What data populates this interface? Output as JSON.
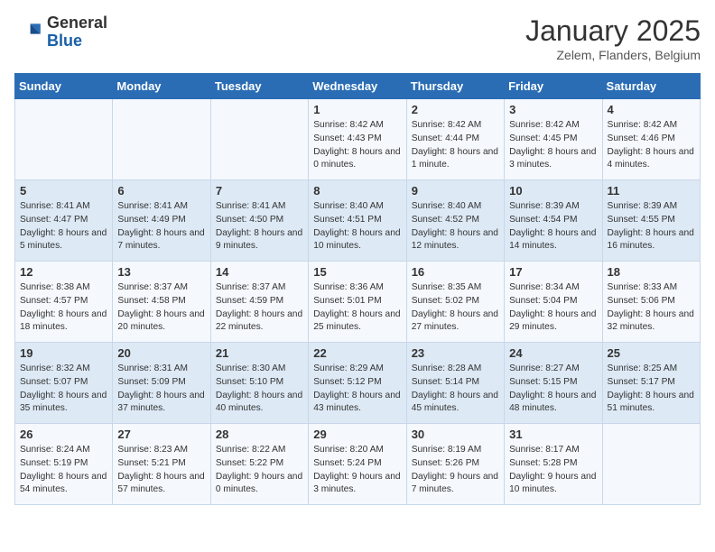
{
  "header": {
    "logo_general": "General",
    "logo_blue": "Blue",
    "month_title": "January 2025",
    "location": "Zelem, Flanders, Belgium"
  },
  "days_of_week": [
    "Sunday",
    "Monday",
    "Tuesday",
    "Wednesday",
    "Thursday",
    "Friday",
    "Saturday"
  ],
  "weeks": [
    [
      {
        "day": "",
        "sunrise": "",
        "sunset": "",
        "daylight": ""
      },
      {
        "day": "",
        "sunrise": "",
        "sunset": "",
        "daylight": ""
      },
      {
        "day": "",
        "sunrise": "",
        "sunset": "",
        "daylight": ""
      },
      {
        "day": "1",
        "sunrise": "Sunrise: 8:42 AM",
        "sunset": "Sunset: 4:43 PM",
        "daylight": "Daylight: 8 hours and 0 minutes."
      },
      {
        "day": "2",
        "sunrise": "Sunrise: 8:42 AM",
        "sunset": "Sunset: 4:44 PM",
        "daylight": "Daylight: 8 hours and 1 minute."
      },
      {
        "day": "3",
        "sunrise": "Sunrise: 8:42 AM",
        "sunset": "Sunset: 4:45 PM",
        "daylight": "Daylight: 8 hours and 3 minutes."
      },
      {
        "day": "4",
        "sunrise": "Sunrise: 8:42 AM",
        "sunset": "Sunset: 4:46 PM",
        "daylight": "Daylight: 8 hours and 4 minutes."
      }
    ],
    [
      {
        "day": "5",
        "sunrise": "Sunrise: 8:41 AM",
        "sunset": "Sunset: 4:47 PM",
        "daylight": "Daylight: 8 hours and 5 minutes."
      },
      {
        "day": "6",
        "sunrise": "Sunrise: 8:41 AM",
        "sunset": "Sunset: 4:49 PM",
        "daylight": "Daylight: 8 hours and 7 minutes."
      },
      {
        "day": "7",
        "sunrise": "Sunrise: 8:41 AM",
        "sunset": "Sunset: 4:50 PM",
        "daylight": "Daylight: 8 hours and 9 minutes."
      },
      {
        "day": "8",
        "sunrise": "Sunrise: 8:40 AM",
        "sunset": "Sunset: 4:51 PM",
        "daylight": "Daylight: 8 hours and 10 minutes."
      },
      {
        "day": "9",
        "sunrise": "Sunrise: 8:40 AM",
        "sunset": "Sunset: 4:52 PM",
        "daylight": "Daylight: 8 hours and 12 minutes."
      },
      {
        "day": "10",
        "sunrise": "Sunrise: 8:39 AM",
        "sunset": "Sunset: 4:54 PM",
        "daylight": "Daylight: 8 hours and 14 minutes."
      },
      {
        "day": "11",
        "sunrise": "Sunrise: 8:39 AM",
        "sunset": "Sunset: 4:55 PM",
        "daylight": "Daylight: 8 hours and 16 minutes."
      }
    ],
    [
      {
        "day": "12",
        "sunrise": "Sunrise: 8:38 AM",
        "sunset": "Sunset: 4:57 PM",
        "daylight": "Daylight: 8 hours and 18 minutes."
      },
      {
        "day": "13",
        "sunrise": "Sunrise: 8:37 AM",
        "sunset": "Sunset: 4:58 PM",
        "daylight": "Daylight: 8 hours and 20 minutes."
      },
      {
        "day": "14",
        "sunrise": "Sunrise: 8:37 AM",
        "sunset": "Sunset: 4:59 PM",
        "daylight": "Daylight: 8 hours and 22 minutes."
      },
      {
        "day": "15",
        "sunrise": "Sunrise: 8:36 AM",
        "sunset": "Sunset: 5:01 PM",
        "daylight": "Daylight: 8 hours and 25 minutes."
      },
      {
        "day": "16",
        "sunrise": "Sunrise: 8:35 AM",
        "sunset": "Sunset: 5:02 PM",
        "daylight": "Daylight: 8 hours and 27 minutes."
      },
      {
        "day": "17",
        "sunrise": "Sunrise: 8:34 AM",
        "sunset": "Sunset: 5:04 PM",
        "daylight": "Daylight: 8 hours and 29 minutes."
      },
      {
        "day": "18",
        "sunrise": "Sunrise: 8:33 AM",
        "sunset": "Sunset: 5:06 PM",
        "daylight": "Daylight: 8 hours and 32 minutes."
      }
    ],
    [
      {
        "day": "19",
        "sunrise": "Sunrise: 8:32 AM",
        "sunset": "Sunset: 5:07 PM",
        "daylight": "Daylight: 8 hours and 35 minutes."
      },
      {
        "day": "20",
        "sunrise": "Sunrise: 8:31 AM",
        "sunset": "Sunset: 5:09 PM",
        "daylight": "Daylight: 8 hours and 37 minutes."
      },
      {
        "day": "21",
        "sunrise": "Sunrise: 8:30 AM",
        "sunset": "Sunset: 5:10 PM",
        "daylight": "Daylight: 8 hours and 40 minutes."
      },
      {
        "day": "22",
        "sunrise": "Sunrise: 8:29 AM",
        "sunset": "Sunset: 5:12 PM",
        "daylight": "Daylight: 8 hours and 43 minutes."
      },
      {
        "day": "23",
        "sunrise": "Sunrise: 8:28 AM",
        "sunset": "Sunset: 5:14 PM",
        "daylight": "Daylight: 8 hours and 45 minutes."
      },
      {
        "day": "24",
        "sunrise": "Sunrise: 8:27 AM",
        "sunset": "Sunset: 5:15 PM",
        "daylight": "Daylight: 8 hours and 48 minutes."
      },
      {
        "day": "25",
        "sunrise": "Sunrise: 8:25 AM",
        "sunset": "Sunset: 5:17 PM",
        "daylight": "Daylight: 8 hours and 51 minutes."
      }
    ],
    [
      {
        "day": "26",
        "sunrise": "Sunrise: 8:24 AM",
        "sunset": "Sunset: 5:19 PM",
        "daylight": "Daylight: 8 hours and 54 minutes."
      },
      {
        "day": "27",
        "sunrise": "Sunrise: 8:23 AM",
        "sunset": "Sunset: 5:21 PM",
        "daylight": "Daylight: 8 hours and 57 minutes."
      },
      {
        "day": "28",
        "sunrise": "Sunrise: 8:22 AM",
        "sunset": "Sunset: 5:22 PM",
        "daylight": "Daylight: 9 hours and 0 minutes."
      },
      {
        "day": "29",
        "sunrise": "Sunrise: 8:20 AM",
        "sunset": "Sunset: 5:24 PM",
        "daylight": "Daylight: 9 hours and 3 minutes."
      },
      {
        "day": "30",
        "sunrise": "Sunrise: 8:19 AM",
        "sunset": "Sunset: 5:26 PM",
        "daylight": "Daylight: 9 hours and 7 minutes."
      },
      {
        "day": "31",
        "sunrise": "Sunrise: 8:17 AM",
        "sunset": "Sunset: 5:28 PM",
        "daylight": "Daylight: 9 hours and 10 minutes."
      },
      {
        "day": "",
        "sunrise": "",
        "sunset": "",
        "daylight": ""
      }
    ]
  ]
}
